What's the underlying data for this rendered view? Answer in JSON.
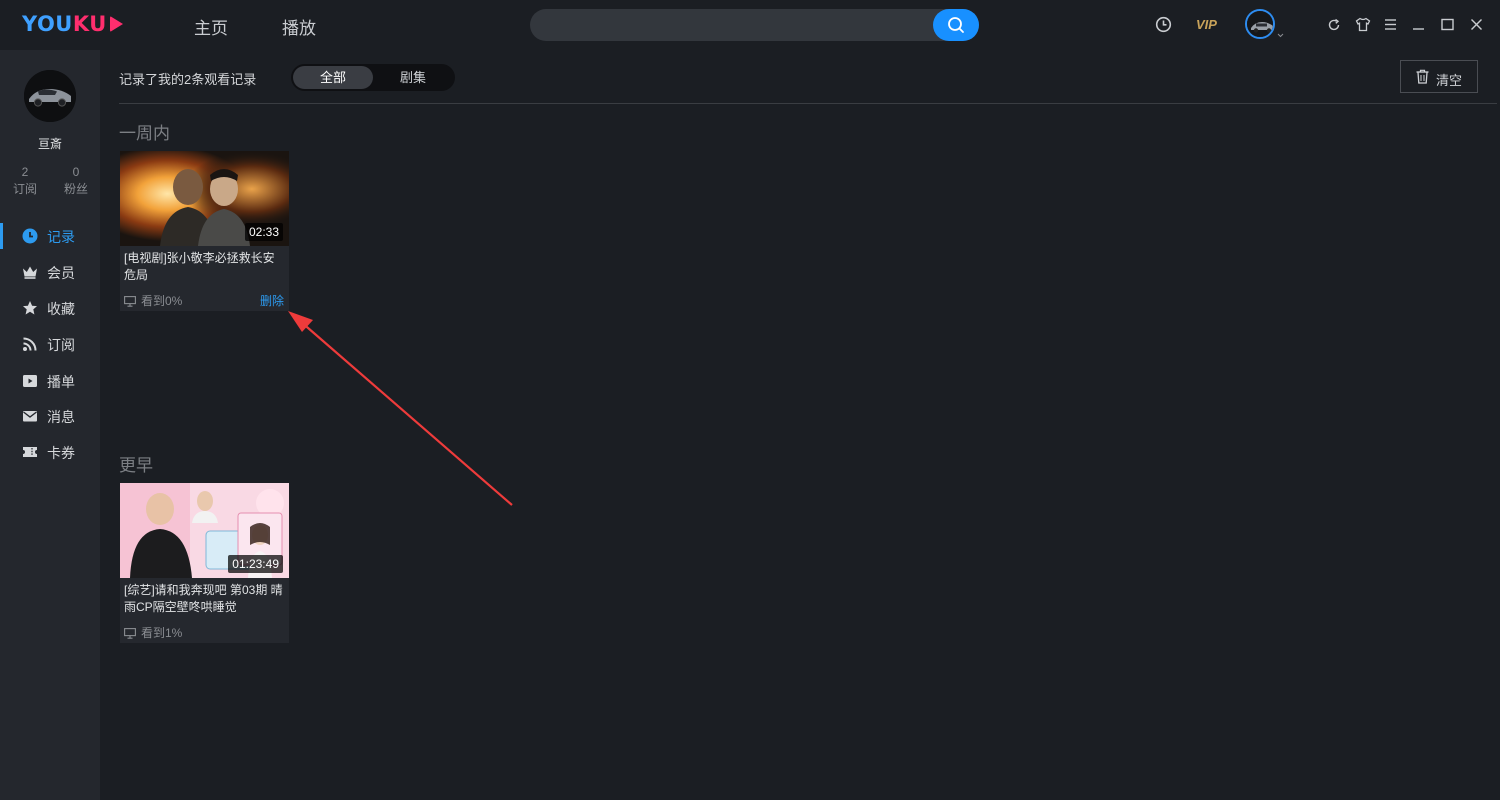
{
  "app": {
    "logo_text_blue": "YOU",
    "logo_text_pink": "KU",
    "nav": [
      {
        "label": "主页"
      },
      {
        "label": "播放"
      }
    ],
    "search_placeholder": "",
    "vip_label": "VIP"
  },
  "sidebar": {
    "username": "亘斎",
    "stats": [
      {
        "value": "2",
        "label": "订阅"
      },
      {
        "value": "0",
        "label": "粉丝"
      }
    ],
    "items": [
      {
        "label": "记录",
        "icon": "clock-icon",
        "active": true
      },
      {
        "label": "会员",
        "icon": "crown-icon"
      },
      {
        "label": "收藏",
        "icon": "star-icon"
      },
      {
        "label": "订阅",
        "icon": "rss-icon"
      },
      {
        "label": "播单",
        "icon": "playlist-icon"
      },
      {
        "label": "消息",
        "icon": "mail-icon"
      },
      {
        "label": "卡券",
        "icon": "ticket-icon"
      }
    ]
  },
  "content": {
    "record_count_text": "记录了我的2条观看记录",
    "filter_tabs": [
      {
        "label": "全部",
        "selected": true
      },
      {
        "label": "剧集"
      }
    ],
    "clear_label": "清空",
    "sections": [
      {
        "title": "一周内",
        "items": [
          {
            "title": "[电视剧]张小敬李必拯救长安危局",
            "duration": "02:33",
            "progress_text": "看到0%",
            "delete_label": "删除"
          }
        ]
      },
      {
        "title": "更早",
        "items": [
          {
            "title": "[综艺]请和我奔现吧 第03期 晴雨CP隔空壁咚哄睡觉",
            "duration": "01:23:49",
            "progress_text": "看到1%"
          }
        ]
      }
    ]
  },
  "colors": {
    "accent": "#2d9bf0",
    "search_button": "#1890ff",
    "logo_pink": "#ff2e6e",
    "vip_gold": "#c9a35a",
    "annotation_arrow": "#ee3b3b"
  }
}
